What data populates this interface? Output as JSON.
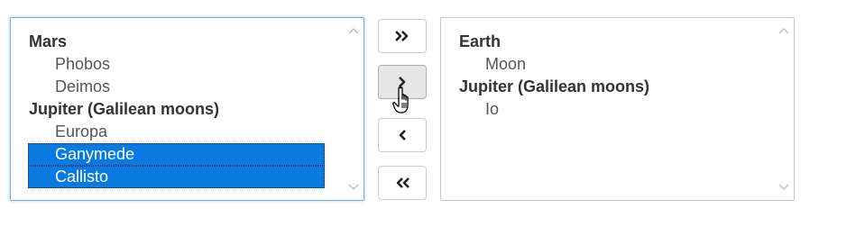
{
  "left_list": {
    "groups": [
      {
        "label": "Mars",
        "options": [
          {
            "label": "Phobos",
            "selected": false
          },
          {
            "label": "Deimos",
            "selected": false
          }
        ]
      },
      {
        "label": "Jupiter (Galilean moons)",
        "options": [
          {
            "label": "Europa",
            "selected": false
          },
          {
            "label": "Ganymede",
            "selected": true
          },
          {
            "label": "Callisto",
            "selected": true
          }
        ]
      }
    ]
  },
  "right_list": {
    "groups": [
      {
        "label": "Earth",
        "options": [
          {
            "label": "Moon",
            "selected": false
          }
        ]
      },
      {
        "label": "Jupiter (Galilean moons)",
        "options": [
          {
            "label": "Io",
            "selected": false
          }
        ]
      }
    ]
  },
  "buttons": {
    "move_all_right": "move-all-right-icon",
    "move_selected_right": "move-right-icon",
    "move_selected_left": "move-left-icon",
    "move_all_left": "move-all-left-icon"
  },
  "colors": {
    "selection": "#0a7ae0",
    "focus_border": "#66afe9",
    "border": "#c8c8c8"
  }
}
